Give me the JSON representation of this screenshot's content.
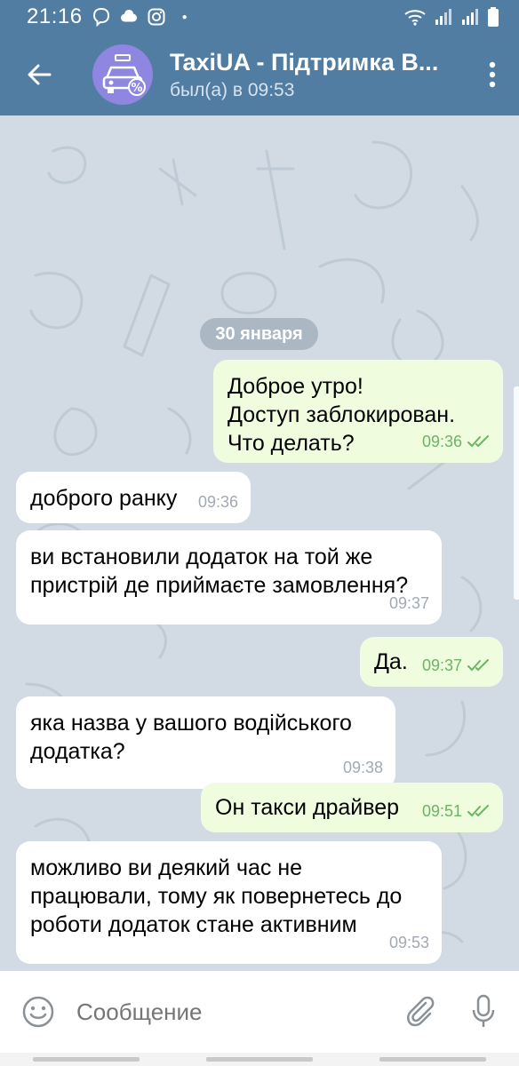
{
  "status_bar": {
    "time": "21:16",
    "icons_left": [
      "viber-icon",
      "messenger-icon",
      "instagram-icon"
    ],
    "icons_right": [
      "wifi-icon",
      "signal-icon",
      "signal-icon",
      "battery-icon"
    ]
  },
  "header": {
    "title": "TaxiUA - Підтримка В...",
    "subtitle": "был(а) в 09:53",
    "avatar_color": "#8e86e0",
    "bar_color": "#517da2"
  },
  "chat": {
    "date_label": "30 января",
    "messages": [
      {
        "side": "out",
        "text": "Доброе утро!\nДоступ заблокирован.\nЧто делать?",
        "time": "09:36",
        "read": true
      },
      {
        "side": "in",
        "text": "доброго ранку",
        "time": "09:36"
      },
      {
        "side": "in",
        "text": "ви встановили додаток на той же\nпристрій де приймаєте замовлення?",
        "time": "09:37"
      },
      {
        "side": "out",
        "text": "Да.",
        "time": "09:37",
        "read": true
      },
      {
        "side": "in",
        "text": "яка назва у вашого водійського\nдодатка?",
        "time": "09:38"
      },
      {
        "side": "out",
        "text": "Он такси драйвер",
        "time": "09:51",
        "read": true
      },
      {
        "side": "in",
        "text": "можливо ви деякий час не\nпрацювали, тому як повернетесь до\nроботи додаток стане активним",
        "time": "09:53"
      }
    ]
  },
  "input": {
    "placeholder": "Сообщение"
  },
  "colors": {
    "incoming_bubble": "#ffffff",
    "outgoing_bubble": "#effdde",
    "read_check": "#6cb464"
  }
}
